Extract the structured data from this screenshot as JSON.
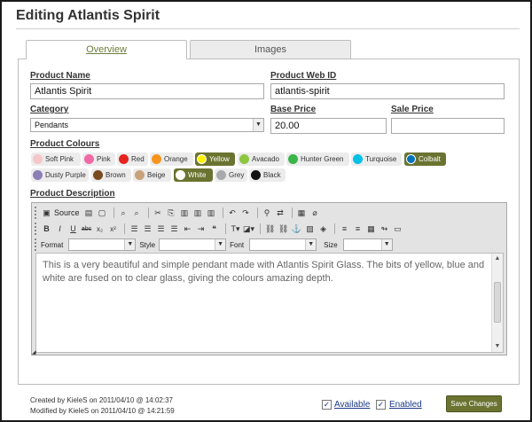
{
  "page_title": "Editing Atlantis Spirit",
  "tabs": [
    {
      "label": "Overview",
      "active": true
    },
    {
      "label": "Images",
      "active": false
    }
  ],
  "fields": {
    "product_name": {
      "label": "Product Name",
      "value": "Atlantis Spirit"
    },
    "product_web_id": {
      "label": "Product Web ID",
      "value": "atlantis-spirit"
    },
    "category": {
      "label": "Category",
      "value": "Pendants"
    },
    "base_price": {
      "label": "Base Price",
      "value": "20.00"
    },
    "sale_price": {
      "label": "Sale Price",
      "value": ""
    }
  },
  "colours": {
    "label": "Product Colours",
    "items": [
      {
        "name": "Soft Pink",
        "color": "#f6c6c9",
        "selected": false
      },
      {
        "name": "Pink",
        "color": "#f06aa5",
        "selected": false
      },
      {
        "name": "Red",
        "color": "#e52420",
        "selected": false
      },
      {
        "name": "Orange",
        "color": "#f7941d",
        "selected": false
      },
      {
        "name": "Yellow",
        "color": "#fff200",
        "selected": true
      },
      {
        "name": "Avacado",
        "color": "#8dc63f",
        "selected": false
      },
      {
        "name": "Hunter Green",
        "color": "#39b54a",
        "selected": false
      },
      {
        "name": "Turquoise",
        "color": "#00c0e8",
        "selected": false
      },
      {
        "name": "Colbalt",
        "color": "#0072bc",
        "selected": true
      },
      {
        "name": "Dusty Purple",
        "color": "#8b7fb6",
        "selected": false
      },
      {
        "name": "Brown",
        "color": "#7b4a1e",
        "selected": false
      },
      {
        "name": "Beige",
        "color": "#c8a27a",
        "selected": false
      },
      {
        "name": "White",
        "color": "#ffffff",
        "selected": true
      },
      {
        "name": "Grey",
        "color": "#a7a9ac",
        "selected": false
      },
      {
        "name": "Black",
        "color": "#111111",
        "selected": false
      }
    ]
  },
  "description": {
    "label": "Product Description",
    "toolbar": {
      "source_label": "Source",
      "format_label": "Format",
      "style_label": "Style",
      "font_label": "Font",
      "size_label": "Size"
    },
    "text": "This is a very beautiful and simple pendant made with Atlantis Spirit Glass. The bits of yellow, blue and white are fused on to clear glass, giving the colours amazing depth."
  },
  "footer": {
    "created": "Created by KieleS on 2011/04/10 @ 14:02:37",
    "modified": "Modified by KieleS on 2011/04/10 @ 14:21:59",
    "available_label": "Available",
    "available_checked": true,
    "enabled_label": "Enabled",
    "enabled_checked": true,
    "save_label": "Save Changes"
  },
  "theme": {
    "accent": "#6b7331",
    "link": "#1b3a8a"
  }
}
